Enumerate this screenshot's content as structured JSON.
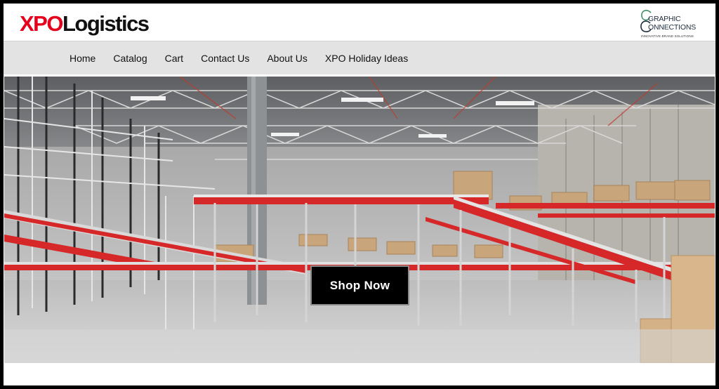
{
  "brand": {
    "logo_part1": "XPO",
    "logo_part2": "Logistics",
    "partner_logo_line1": "GRAPHIC",
    "partner_logo_line2": "ONNECTIONS",
    "partner_logo_tagline": "INNOVATIVE BRAND SOLUTIONS"
  },
  "nav": {
    "items": [
      {
        "label": "Home"
      },
      {
        "label": "Catalog"
      },
      {
        "label": "Cart"
      },
      {
        "label": "Contact Us"
      },
      {
        "label": "About Us"
      },
      {
        "label": "XPO Holiday Ideas"
      }
    ]
  },
  "hero": {
    "image": "warehouse-conveyor-photo",
    "cta_label": "Shop Now"
  },
  "colors": {
    "brand_red": "#e5001c",
    "nav_bg": "#e3e3e3",
    "cta_bg": "#000000"
  }
}
